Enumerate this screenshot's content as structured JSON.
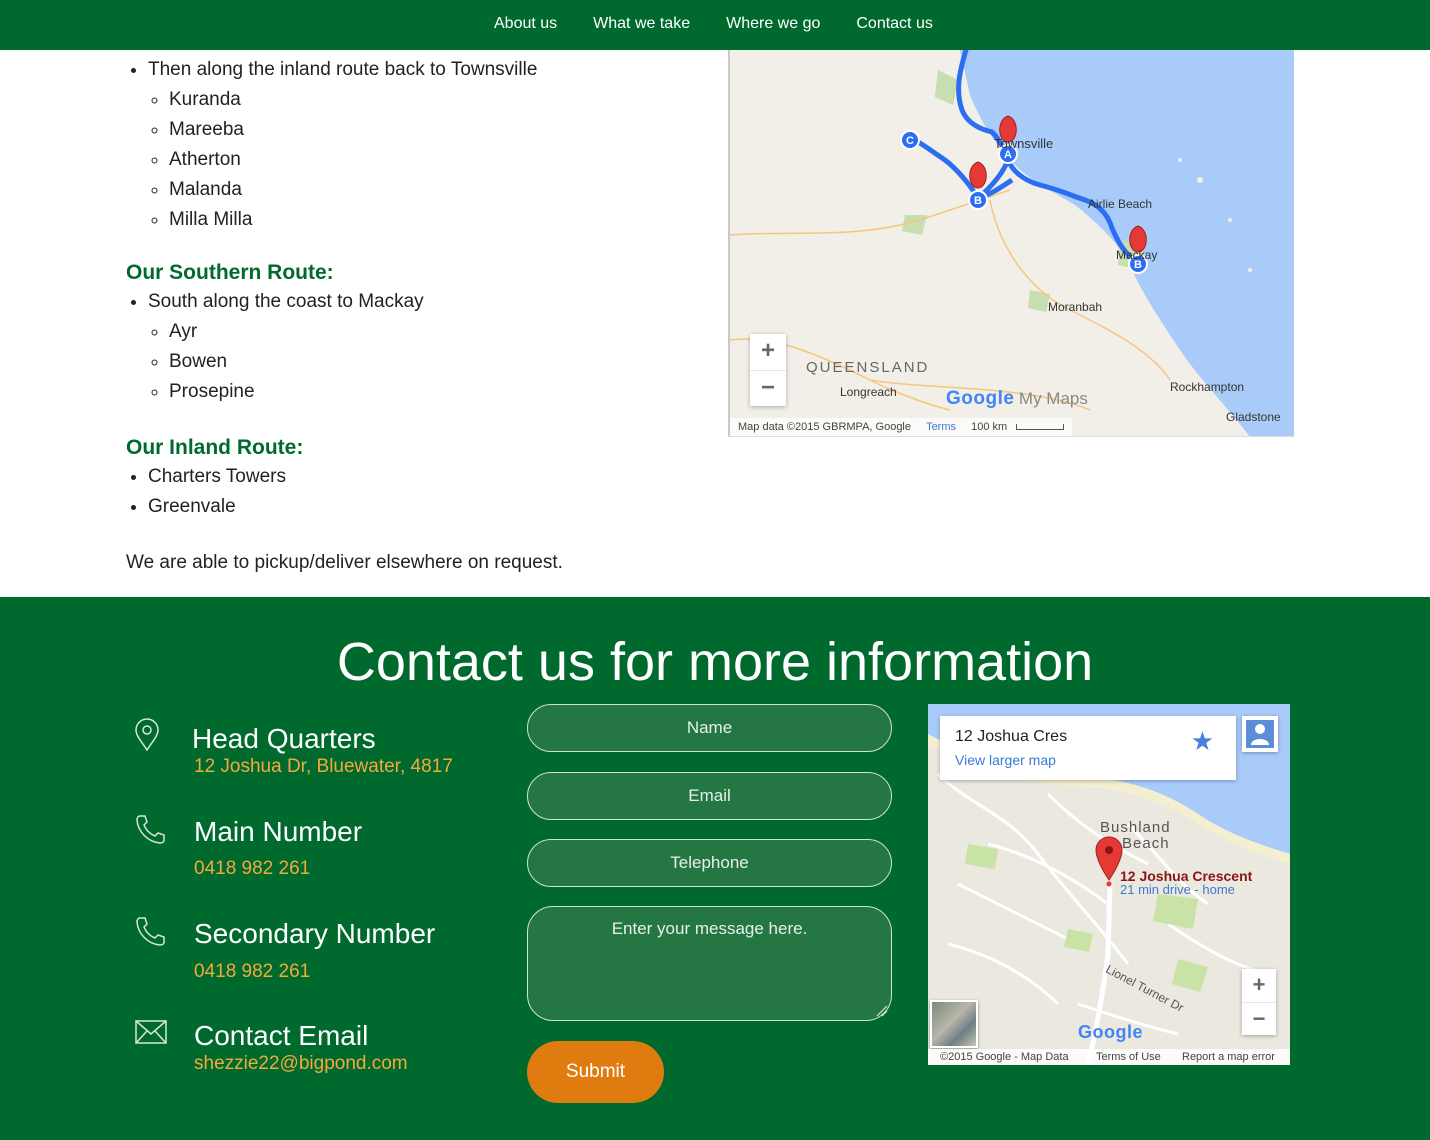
{
  "nav": {
    "items": [
      "About us",
      "What we take",
      "Where we go",
      "Contact us"
    ]
  },
  "routes": {
    "northern_tail": {
      "item": "Then along the inland route back to Townsville",
      "stops": [
        "Kuranda",
        "Mareeba",
        "Atherton",
        "Malanda",
        "Milla Milla"
      ]
    },
    "southern": {
      "heading": "Our Southern Route:",
      "item": "South along the coast to Mackay",
      "stops": [
        "Ayr",
        "Bowen",
        "Prosepine"
      ]
    },
    "inland": {
      "heading": "Our Inland Route:",
      "items": [
        "Charters Towers",
        "Greenvale"
      ]
    },
    "note": "We are able to pickup/deliver elsewhere on request."
  },
  "route_map": {
    "labels": {
      "townsville": "Townsville",
      "airlie": "Airlie Beach",
      "mackay": "Mackay",
      "moranbah": "Moranbah",
      "queensland": "QUEENSLAND",
      "longreach": "Longreach",
      "rockhampton": "Rockhampton",
      "gladstone": "Gladstone"
    },
    "markers": [
      "A",
      "B",
      "B",
      "C"
    ],
    "brand": "Google",
    "brand_suffix": "My Maps",
    "zoom_in": "+",
    "zoom_out": "−",
    "footer": {
      "data": "Map data ©2015 GBRMPA, Google",
      "terms": "Terms",
      "scale": "100 km"
    }
  },
  "contact": {
    "heading": "Contact us for more information",
    "info": [
      {
        "title": "Head Quarters",
        "value": "12 Joshua Dr, Bluewater, 4817",
        "icon": "location-pin-icon"
      },
      {
        "title": "Main Number",
        "value": "0418 982 261",
        "icon": "phone-icon"
      },
      {
        "title": "Secondary Number",
        "value": "0418 982 261",
        "icon": "phone-icon"
      },
      {
        "title": "Contact Email",
        "value": "shezzie22@bigpond.com",
        "icon": "envelope-icon"
      }
    ],
    "form": {
      "name_placeholder": "Name",
      "email_placeholder": "Email",
      "telephone_placeholder": "Telephone",
      "message_placeholder": "Enter your message here.",
      "submit_label": "Submit"
    },
    "accent_color": "#f2a93b",
    "brand_color": "#006a2e",
    "button_color": "#e07b0f"
  },
  "local_map": {
    "place_name": "12 Joshua Cres",
    "view_larger": "View larger map",
    "suburb_line1": "Bushland",
    "suburb_line2": "Beach",
    "pin_label": "12 Joshua Crescent",
    "pin_sub": "21 min drive - home",
    "road": "Lionel Turner Dr",
    "brand": "Google",
    "zoom_in": "+",
    "zoom_out": "−",
    "footer": {
      "copyright": "©2015 Google - Map Data",
      "terms": "Terms of Use",
      "report": "Report a map error"
    }
  }
}
